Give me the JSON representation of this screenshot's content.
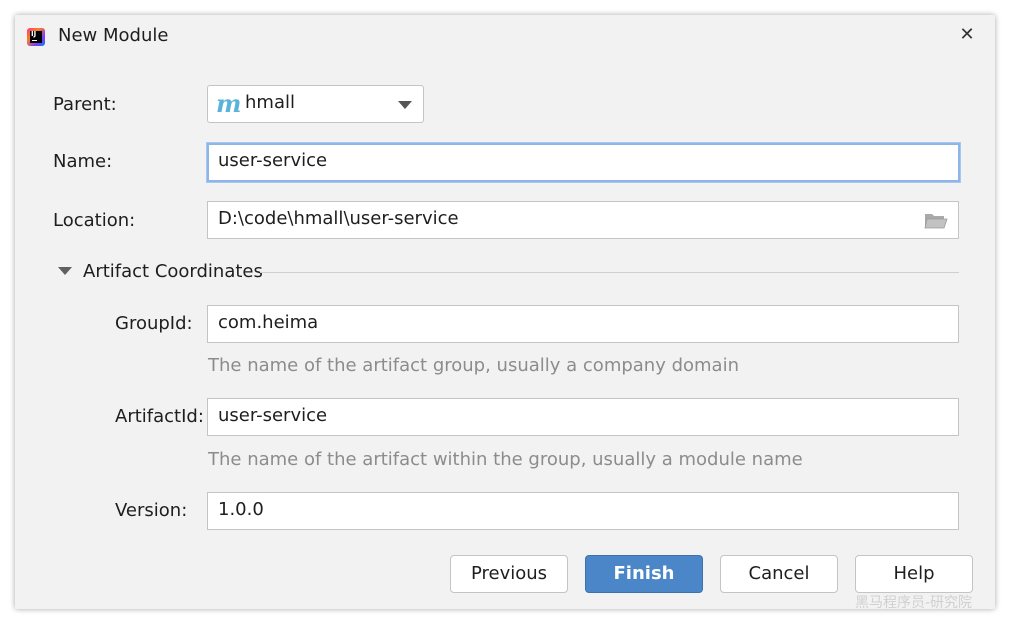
{
  "window": {
    "title": "New Module",
    "close_glyph": "✕",
    "app_icon": "intellij-idea-icon",
    "app_icon_text": "IJ"
  },
  "form": {
    "parent": {
      "label": "Parent:",
      "value": "hmall",
      "icon": "maven-m-icon",
      "icon_glyph": "m"
    },
    "name": {
      "label": "Name:",
      "value": "user-service"
    },
    "location": {
      "label": "Location:",
      "value": "D:\\code\\hmall\\user-service",
      "icon": "folder-icon"
    }
  },
  "artifact_section": {
    "title": "Artifact Coordinates",
    "expanded": true,
    "group_id": {
      "label": "GroupId:",
      "value": "com.heima",
      "hint": "The name of the artifact group, usually a company domain"
    },
    "artifact_id": {
      "label": "ArtifactId:",
      "value": "user-service",
      "hint": "The name of the artifact within the group, usually a module name"
    },
    "version": {
      "label": "Version:",
      "value": "1.0.0"
    }
  },
  "buttons": {
    "previous": "Previous",
    "finish": "Finish",
    "cancel": "Cancel",
    "help": "Help"
  },
  "watermark": "黑马程序员-研究院",
  "colors": {
    "primary_button": "#4a86c8",
    "focus_ring": "#8fb5e8",
    "maven_icon": "#5ab4d9",
    "hint_text": "#8c8c8c"
  }
}
